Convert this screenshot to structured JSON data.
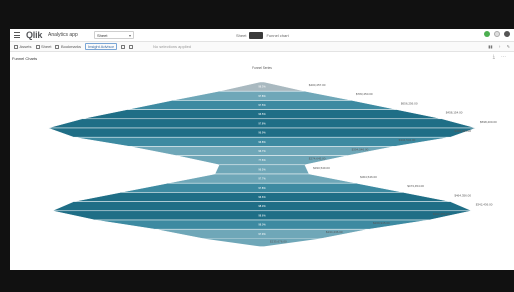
{
  "app": {
    "logo_text": "Qlik",
    "title": "Analytics app",
    "sheet_select": "Sheet",
    "center_label": "Sheet ",
    "center_label2": "Funnel chart"
  },
  "toolbar": {
    "items": [
      "Assets",
      "Sheet",
      "Bookmarks"
    ],
    "insight": "Insight Advisor",
    "selection": "No selections applied"
  },
  "sheet": {
    "title": "Funnel Charts",
    "chart_header": "Funnel Series"
  },
  "colors": {
    "teal_dark": "#1f6e86",
    "teal_mid": "#3d8aa1",
    "teal_light": "#6fa7b8",
    "grey_top": "#a9b9c0"
  },
  "chart_data": {
    "type": "area",
    "title": "Funnel Series",
    "bands": [
      {
        "label": "98.3%",
        "value": 0.2
      },
      {
        "label": "97.8%",
        "value": 0.42
      },
      {
        "label": "97.5%",
        "value": 0.63
      },
      {
        "label": "96.5%",
        "value": 0.84
      },
      {
        "label": "97.8%",
        "value": 1.0
      },
      {
        "label": "96.9%",
        "value": 0.88
      },
      {
        "label": "96.8%",
        "value": 0.62
      },
      {
        "label": "96.7%",
        "value": 0.4
      },
      {
        "label": "77.6%",
        "value": 0.2
      },
      {
        "label": "96.5%",
        "value": 0.22
      },
      {
        "label": "97.7%",
        "value": 0.44
      },
      {
        "label": "97.8%",
        "value": 0.66
      },
      {
        "label": "96.6%",
        "value": 0.88
      },
      {
        "label": "98.3%",
        "value": 0.98
      },
      {
        "label": "98.6%",
        "value": 0.78
      },
      {
        "label": "98.0%",
        "value": 0.5
      },
      {
        "label": "97.9%",
        "value": 0.28
      }
    ],
    "side_labels": [
      "$400,457.00",
      "$783,450.00",
      "$656,256.00",
      "$458,154.00",
      "$598,400.00",
      "$468,324.00",
      "$334,534.00",
      "$394,546.00",
      "$274,645.00",
      "$330,549.00",
      "$304,546.00",
      "$473,454.00",
      "$464,356.00",
      "$342,436.00",
      "$302,354.00",
      "$269,945.00",
      "$234,436.00",
      "$235,676.00"
    ]
  }
}
